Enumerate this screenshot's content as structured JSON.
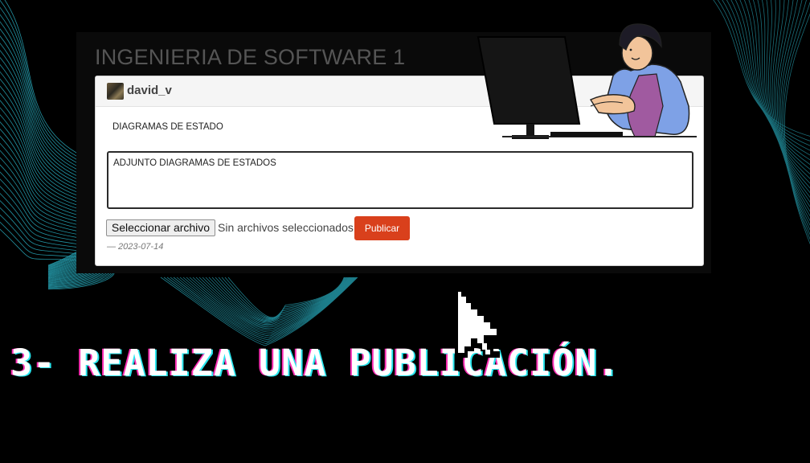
{
  "course": {
    "title": "INGENIERIA DE SOFTWARE 1"
  },
  "post": {
    "author": "david_v",
    "subject": "DIAGRAMAS DE ESTADO",
    "body": "ADJUNTO DIAGRAMAS DE ESTADOS",
    "file_button_label": "Seleccionar archivo",
    "file_status": "Sin archivos seleccionados",
    "publish_label": "Publicar",
    "date": "— 2023-07-14"
  },
  "headline": {
    "text": "3- REALIZA UNA PUBLICACIÓN."
  },
  "colors": {
    "publish_button": "#d9401c",
    "wave_lines": "#2bb6c9",
    "headline_pink": "#ff2fb6",
    "headline_cyan": "#28e6ee",
    "sweater": "#7ea1e6",
    "shirt": "#a05aa0"
  },
  "icons": [
    "avatar",
    "computer-monitor-illustration",
    "pixel-arrow-cursor-icon"
  ]
}
